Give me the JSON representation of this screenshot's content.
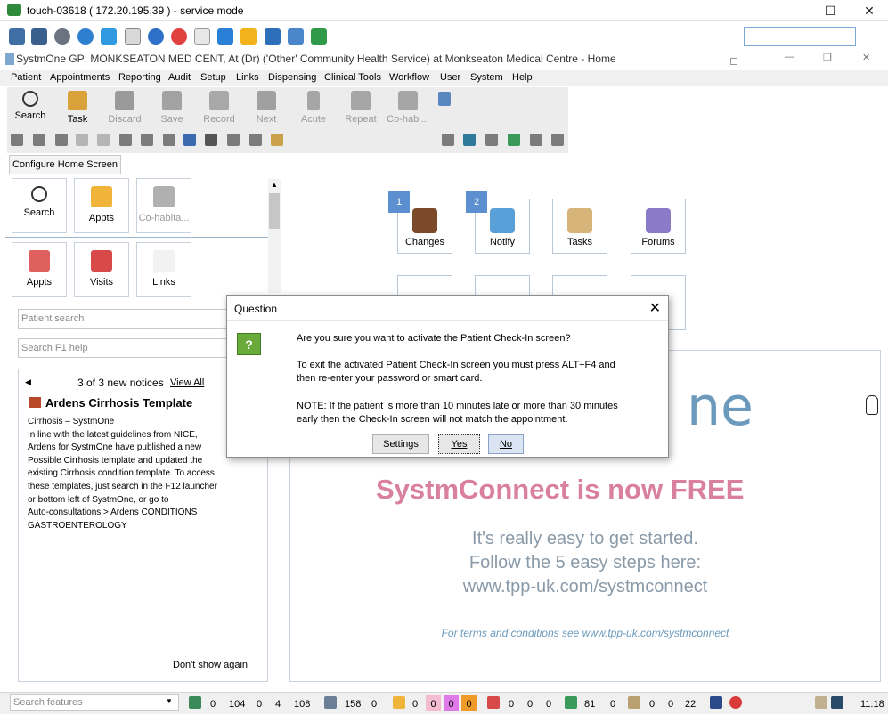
{
  "remote": {
    "title": "touch-03618 ( 172.20.195.39 ) - service mode",
    "minimize": "—",
    "maximize": "☐",
    "close": "✕"
  },
  "app": {
    "title": "SystmOne GP: MONKSEATON MED CENT, At (Dr) ('Other' Community Health Service) at Monkseaton Medical Centre - Home",
    "win_min": "—",
    "win_restore": "❐",
    "win_close": "✕"
  },
  "menu": [
    "Patient",
    "Appointments",
    "Reporting",
    "Audit",
    "Setup",
    "Links",
    "Dispensing",
    "Clinical Tools",
    "Workflow",
    "User",
    "System",
    "Help"
  ],
  "toolbar": {
    "buttons": [
      {
        "label": "Search",
        "icon": "magnifier-icon"
      },
      {
        "label": "Task",
        "icon": "task-icon"
      },
      {
        "label": "Discard",
        "icon": "discard-icon"
      },
      {
        "label": "Save",
        "icon": "save-icon"
      },
      {
        "label": "Record",
        "icon": "record-icon"
      },
      {
        "label": "Next",
        "icon": "next-icon"
      },
      {
        "label": "Acute",
        "icon": "acute-icon"
      },
      {
        "label": "Repeat",
        "icon": "repeat-icon"
      },
      {
        "label": "Co-habi...",
        "icon": "cohabit-icon"
      }
    ],
    "configure": "Configure Home Screen"
  },
  "left_tiles": [
    {
      "label": "Search"
    },
    {
      "label": "Appts"
    },
    {
      "label": "Co-habita..."
    },
    {
      "label": "Appts"
    },
    {
      "label": "Visits"
    },
    {
      "label": "Links"
    }
  ],
  "patient_search_placeholder": "Patient search",
  "help_search_placeholder": "Search F1 help",
  "notices": {
    "nav_prev": "◀",
    "count": "3 of 3 new notices",
    "view_all": "View All",
    "heading": "Ardens Cirrhosis Template",
    "lines": [
      "Cirrhosis – SystmOne",
      "In line with the latest guidelines from NICE,",
      "Ardens for SystmOne have published a new",
      "Possible Cirrhosis template and updated the",
      "existing Cirrhosis condition template. To access",
      "these templates, just search in the F12 launcher",
      "or bottom left of SystmOne, or go to",
      "Auto-consultations > Ardens CONDITIONS",
      "GASTROENTEROLOGY"
    ],
    "dont_show": "Don't show again"
  },
  "home_tiles": [
    {
      "label": "Changes",
      "badge": "1"
    },
    {
      "label": "Notify",
      "badge": "2"
    },
    {
      "label": "Tasks"
    },
    {
      "label": "Forums"
    }
  ],
  "promo": {
    "logo_text": "ne",
    "headline": "SystmConnect is now FREE",
    "line1": "It's really easy to get started.",
    "line2": "Follow the 5 easy steps here:",
    "url": "www.tpp-uk.com/systmconnect",
    "terms": "For terms and conditions see www.tpp-uk.com/systmconnect"
  },
  "dialog": {
    "title": "Question",
    "close": "✕",
    "icon_text": "?",
    "line1": "Are you sure you want to activate the Patient Check-In screen?",
    "para2": [
      "To exit the activated Patient Check-In screen you must press ALT+F4 and",
      "then re-enter your password or smart card."
    ],
    "para3": [
      "NOTE: If the patient is more than 10 minutes late or more than 30 minutes",
      "early then the Check-In screen will not match the appointment."
    ],
    "buttons": {
      "settings": "Settings",
      "yes": "Yes",
      "no": "No"
    }
  },
  "status": {
    "search_placeholder": "Search features",
    "counts": [
      "0",
      "104",
      "0",
      "4",
      "108",
      "158",
      "0",
      "0",
      "0",
      "0",
      "0",
      "0",
      "0",
      "0",
      "81",
      "0",
      "0",
      "0",
      "22"
    ],
    "time": "11:18"
  },
  "colors": {
    "promo_pink": "#d97f9f",
    "promo_gray": "#8a9aa8",
    "promo_blue": "#6b9abc",
    "badge_blue": "#5b8fd0"
  }
}
